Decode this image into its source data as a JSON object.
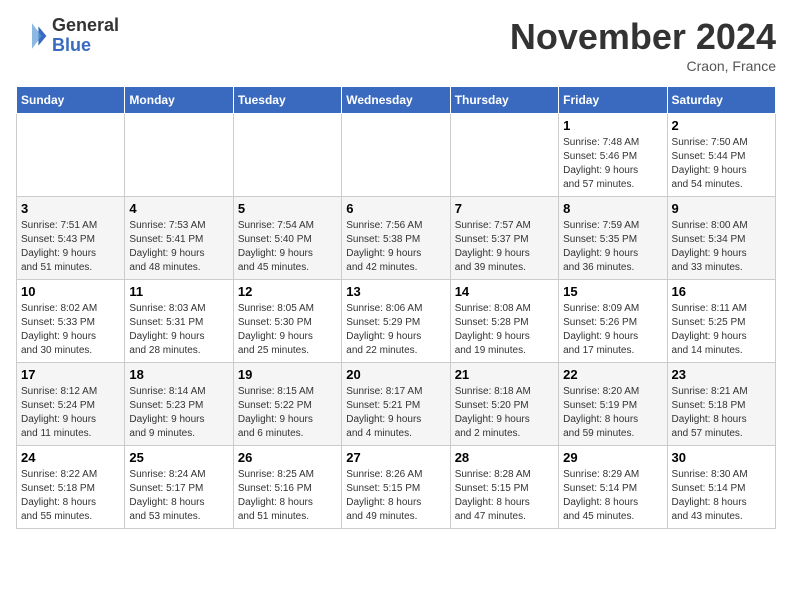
{
  "header": {
    "logo_line1": "General",
    "logo_line2": "Blue",
    "month": "November 2024",
    "location": "Craon, France"
  },
  "weekdays": [
    "Sunday",
    "Monday",
    "Tuesday",
    "Wednesday",
    "Thursday",
    "Friday",
    "Saturday"
  ],
  "weeks": [
    [
      {
        "day": "",
        "info": ""
      },
      {
        "day": "",
        "info": ""
      },
      {
        "day": "",
        "info": ""
      },
      {
        "day": "",
        "info": ""
      },
      {
        "day": "",
        "info": ""
      },
      {
        "day": "1",
        "info": "Sunrise: 7:48 AM\nSunset: 5:46 PM\nDaylight: 9 hours\nand 57 minutes."
      },
      {
        "day": "2",
        "info": "Sunrise: 7:50 AM\nSunset: 5:44 PM\nDaylight: 9 hours\nand 54 minutes."
      }
    ],
    [
      {
        "day": "3",
        "info": "Sunrise: 7:51 AM\nSunset: 5:43 PM\nDaylight: 9 hours\nand 51 minutes."
      },
      {
        "day": "4",
        "info": "Sunrise: 7:53 AM\nSunset: 5:41 PM\nDaylight: 9 hours\nand 48 minutes."
      },
      {
        "day": "5",
        "info": "Sunrise: 7:54 AM\nSunset: 5:40 PM\nDaylight: 9 hours\nand 45 minutes."
      },
      {
        "day": "6",
        "info": "Sunrise: 7:56 AM\nSunset: 5:38 PM\nDaylight: 9 hours\nand 42 minutes."
      },
      {
        "day": "7",
        "info": "Sunrise: 7:57 AM\nSunset: 5:37 PM\nDaylight: 9 hours\nand 39 minutes."
      },
      {
        "day": "8",
        "info": "Sunrise: 7:59 AM\nSunset: 5:35 PM\nDaylight: 9 hours\nand 36 minutes."
      },
      {
        "day": "9",
        "info": "Sunrise: 8:00 AM\nSunset: 5:34 PM\nDaylight: 9 hours\nand 33 minutes."
      }
    ],
    [
      {
        "day": "10",
        "info": "Sunrise: 8:02 AM\nSunset: 5:33 PM\nDaylight: 9 hours\nand 30 minutes."
      },
      {
        "day": "11",
        "info": "Sunrise: 8:03 AM\nSunset: 5:31 PM\nDaylight: 9 hours\nand 28 minutes."
      },
      {
        "day": "12",
        "info": "Sunrise: 8:05 AM\nSunset: 5:30 PM\nDaylight: 9 hours\nand 25 minutes."
      },
      {
        "day": "13",
        "info": "Sunrise: 8:06 AM\nSunset: 5:29 PM\nDaylight: 9 hours\nand 22 minutes."
      },
      {
        "day": "14",
        "info": "Sunrise: 8:08 AM\nSunset: 5:28 PM\nDaylight: 9 hours\nand 19 minutes."
      },
      {
        "day": "15",
        "info": "Sunrise: 8:09 AM\nSunset: 5:26 PM\nDaylight: 9 hours\nand 17 minutes."
      },
      {
        "day": "16",
        "info": "Sunrise: 8:11 AM\nSunset: 5:25 PM\nDaylight: 9 hours\nand 14 minutes."
      }
    ],
    [
      {
        "day": "17",
        "info": "Sunrise: 8:12 AM\nSunset: 5:24 PM\nDaylight: 9 hours\nand 11 minutes."
      },
      {
        "day": "18",
        "info": "Sunrise: 8:14 AM\nSunset: 5:23 PM\nDaylight: 9 hours\nand 9 minutes."
      },
      {
        "day": "19",
        "info": "Sunrise: 8:15 AM\nSunset: 5:22 PM\nDaylight: 9 hours\nand 6 minutes."
      },
      {
        "day": "20",
        "info": "Sunrise: 8:17 AM\nSunset: 5:21 PM\nDaylight: 9 hours\nand 4 minutes."
      },
      {
        "day": "21",
        "info": "Sunrise: 8:18 AM\nSunset: 5:20 PM\nDaylight: 9 hours\nand 2 minutes."
      },
      {
        "day": "22",
        "info": "Sunrise: 8:20 AM\nSunset: 5:19 PM\nDaylight: 8 hours\nand 59 minutes."
      },
      {
        "day": "23",
        "info": "Sunrise: 8:21 AM\nSunset: 5:18 PM\nDaylight: 8 hours\nand 57 minutes."
      }
    ],
    [
      {
        "day": "24",
        "info": "Sunrise: 8:22 AM\nSunset: 5:18 PM\nDaylight: 8 hours\nand 55 minutes."
      },
      {
        "day": "25",
        "info": "Sunrise: 8:24 AM\nSunset: 5:17 PM\nDaylight: 8 hours\nand 53 minutes."
      },
      {
        "day": "26",
        "info": "Sunrise: 8:25 AM\nSunset: 5:16 PM\nDaylight: 8 hours\nand 51 minutes."
      },
      {
        "day": "27",
        "info": "Sunrise: 8:26 AM\nSunset: 5:15 PM\nDaylight: 8 hours\nand 49 minutes."
      },
      {
        "day": "28",
        "info": "Sunrise: 8:28 AM\nSunset: 5:15 PM\nDaylight: 8 hours\nand 47 minutes."
      },
      {
        "day": "29",
        "info": "Sunrise: 8:29 AM\nSunset: 5:14 PM\nDaylight: 8 hours\nand 45 minutes."
      },
      {
        "day": "30",
        "info": "Sunrise: 8:30 AM\nSunset: 5:14 PM\nDaylight: 8 hours\nand 43 minutes."
      }
    ]
  ]
}
